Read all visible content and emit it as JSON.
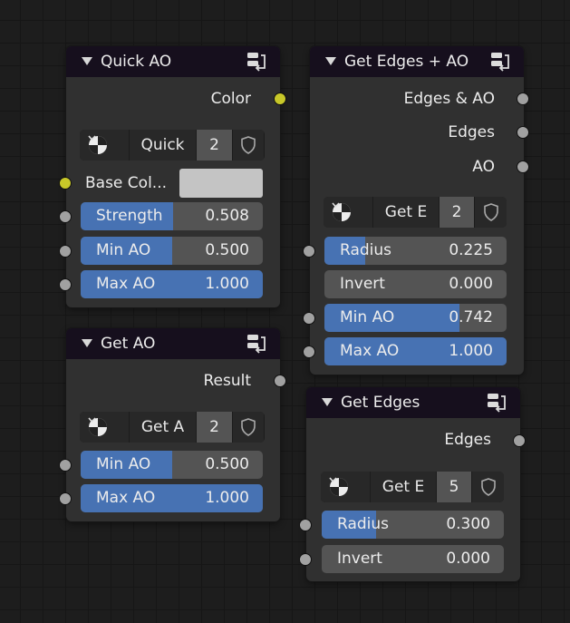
{
  "nodes": {
    "quick_ao": {
      "title": "Quick AO",
      "output": "Color",
      "selector": {
        "name": "Quick",
        "count": "2"
      },
      "base_color_label": "Base Col...",
      "base_color_value": "#c4c4c4",
      "fields": [
        {
          "label": "Strength",
          "value": "0.508",
          "fill": 0.508
        },
        {
          "label": "Min AO",
          "value": "0.500",
          "fill": 0.5
        },
        {
          "label": "Max AO",
          "value": "1.000",
          "fill": 1.0
        }
      ]
    },
    "get_ao": {
      "title": "Get AO",
      "output": "Result",
      "selector": {
        "name": "Get A",
        "count": "2"
      },
      "fields": [
        {
          "label": "Min AO",
          "value": "0.500",
          "fill": 0.5
        },
        {
          "label": "Max AO",
          "value": "1.000",
          "fill": 1.0
        }
      ]
    },
    "get_edges_ao": {
      "title": "Get Edges + AO",
      "outputs": [
        "Edges & AO",
        "Edges",
        "AO"
      ],
      "selector": {
        "name": "Get E",
        "count": "2"
      },
      "fields": [
        {
          "label": "Radius",
          "value": "0.225",
          "fill": 0.225
        },
        {
          "label": "Invert",
          "value": "0.000",
          "fill": 0.0
        },
        {
          "label": "Min AO",
          "value": "0.742",
          "fill": 0.742
        },
        {
          "label": "Max AO",
          "value": "1.000",
          "fill": 1.0
        }
      ]
    },
    "get_edges": {
      "title": "Get Edges",
      "output": "Edges",
      "selector": {
        "name": "Get E",
        "count": "5"
      },
      "fields": [
        {
          "label": "Radius",
          "value": "0.300",
          "fill": 0.3
        },
        {
          "label": "Invert",
          "value": "0.000",
          "fill": 0.0
        }
      ]
    }
  },
  "colors": {
    "background": "#1d1d1d",
    "node_body": "#303030",
    "node_header": "#160f1d",
    "slider_fill": "#4772b3",
    "slider_track": "#545454",
    "socket_grey": "#a1a1a1",
    "socket_yellow": "#c7c729"
  },
  "icons": [
    "collapse-arrow-icon",
    "node-group-icon",
    "material-sphere-icon",
    "chevron-down-icon",
    "fake-user-shield-icon"
  ]
}
